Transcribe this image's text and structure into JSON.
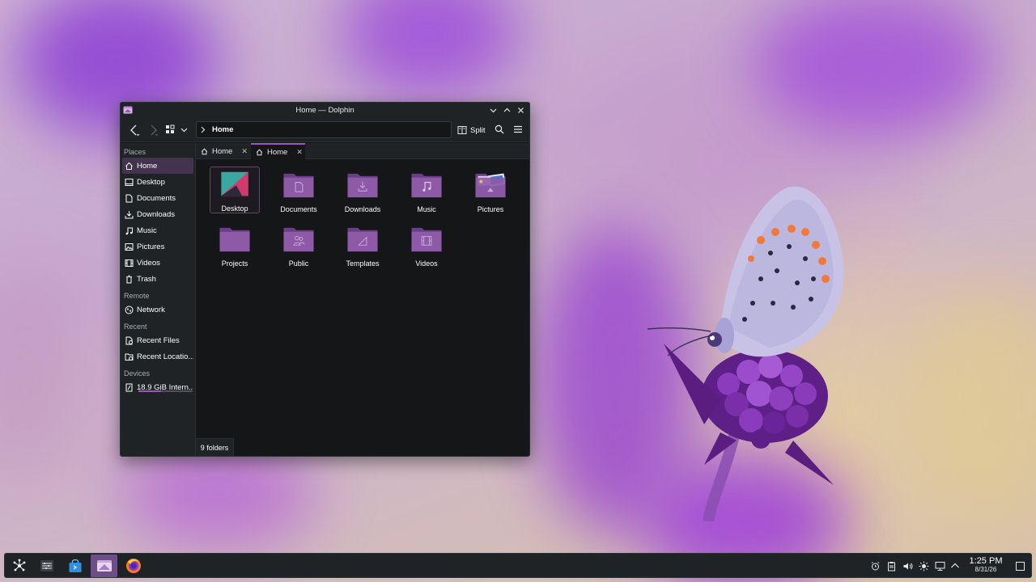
{
  "window": {
    "title": "Home — Dolphin",
    "url_crumb": "Home",
    "split_label": "Split",
    "status": "9 folders"
  },
  "tabs": [
    {
      "label": "Home"
    },
    {
      "label": "Home"
    }
  ],
  "sidebar": {
    "sections": {
      "places": "Places",
      "remote": "Remote",
      "recent": "Recent",
      "devices": "Devices"
    },
    "places": [
      {
        "label": "Home",
        "icon": "home-icon"
      },
      {
        "label": "Desktop",
        "icon": "desktop-icon"
      },
      {
        "label": "Documents",
        "icon": "documents-icon"
      },
      {
        "label": "Downloads",
        "icon": "downloads-icon"
      },
      {
        "label": "Music",
        "icon": "music-icon"
      },
      {
        "label": "Pictures",
        "icon": "pictures-icon"
      },
      {
        "label": "Videos",
        "icon": "videos-icon"
      },
      {
        "label": "Trash",
        "icon": "trash-icon"
      }
    ],
    "remote": [
      {
        "label": "Network",
        "icon": "network-icon"
      }
    ],
    "recent": [
      {
        "label": "Recent Files",
        "icon": "recent-files-icon"
      },
      {
        "label": "Recent Locatio...",
        "icon": "recent-locations-icon"
      }
    ],
    "devices": [
      {
        "label": "18.9 GiB Intern...",
        "icon": "drive-icon",
        "usage": 0.42
      }
    ]
  },
  "folders": [
    {
      "label": "Desktop"
    },
    {
      "label": "Documents"
    },
    {
      "label": "Downloads"
    },
    {
      "label": "Music"
    },
    {
      "label": "Pictures"
    },
    {
      "label": "Projects"
    },
    {
      "label": "Public"
    },
    {
      "label": "Templates"
    },
    {
      "label": "Videos"
    }
  ],
  "taskbar": {
    "time": "1:25 PM",
    "date": "8/31/26"
  },
  "colors": {
    "accent": "#9b59c0",
    "folder": "#8e5aa8",
    "window_bg": "#141618",
    "panel_bg": "#202326"
  }
}
